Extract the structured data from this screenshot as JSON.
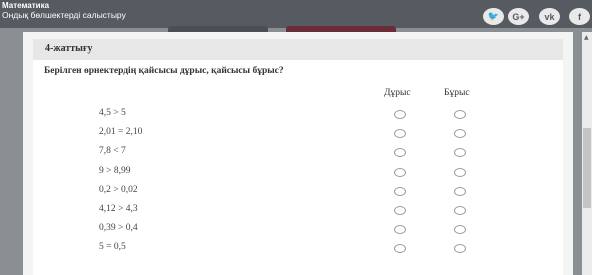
{
  "header": {
    "subject": "Математика",
    "topic": "Ондық бөлшектерді салыстыру",
    "social": [
      {
        "icon": "twitter-icon",
        "glyph": "🐦"
      },
      {
        "icon": "google-plus-icon",
        "glyph": "G+"
      },
      {
        "icon": "vk-icon",
        "glyph": "vk"
      },
      {
        "icon": "facebook-icon",
        "glyph": "f"
      }
    ]
  },
  "exercise": {
    "title": "4-жаттығу",
    "question": "Берілген өрнектердің қайсысы дұрыс, қайсысы бұрыс?",
    "col_true": "Дұрыс",
    "col_false": "Бұрыс",
    "rows": [
      {
        "expr": "4,5 > 5",
        "answer": null
      },
      {
        "expr": "2,01 = 2,10",
        "answer": null
      },
      {
        "expr": "7,8 < 7",
        "answer": null
      },
      {
        "expr": "9 > 8,99",
        "answer": null
      },
      {
        "expr": "0,2 > 0,02",
        "answer": null
      },
      {
        "expr": "4,12 > 4,3",
        "answer": null
      },
      {
        "expr": "0,39 > 0,4",
        "answer": null
      },
      {
        "expr": "5 = 0,5",
        "answer": null
      }
    ]
  },
  "colors": {
    "topbar": "#555b60",
    "accent_tab": "#6a2c36",
    "card_bg": "#ffffff"
  }
}
